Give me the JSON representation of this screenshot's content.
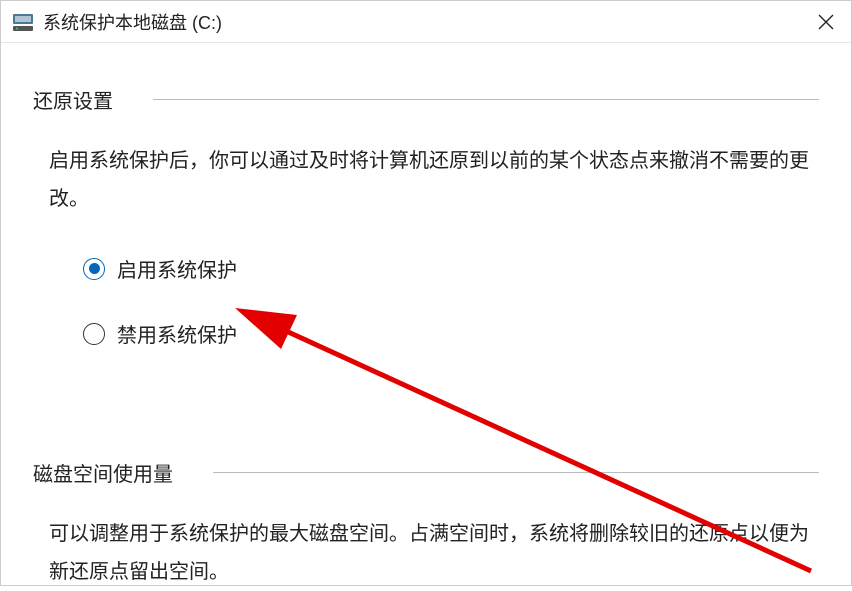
{
  "titlebar": {
    "title": "系统保护本地磁盘 (C:)"
  },
  "restore_settings": {
    "heading": "还原设置",
    "description": "启用系统保护后，你可以通过及时将计算机还原到以前的某个状态点来撤消不需要的更改。",
    "options": {
      "enable_label": "启用系统保护",
      "disable_label": "禁用系统保护",
      "selected": "enable"
    }
  },
  "disk_usage": {
    "heading": "磁盘空间使用量",
    "description": "可以调整用于系统保护的最大磁盘空间。占满空间时，系统将删除较旧的还原点以便为新还原点留出空间。"
  }
}
